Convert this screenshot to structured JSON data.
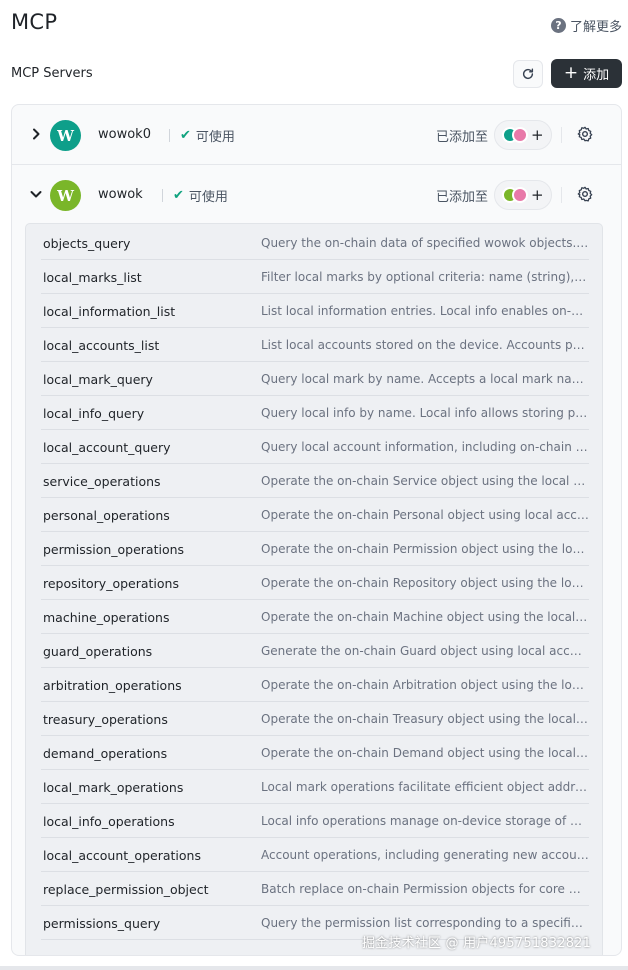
{
  "header": {
    "title": "MCP",
    "learn_more": "了解更多",
    "help_icon": "question-circle-icon"
  },
  "toolbar": {
    "section_title": "MCP Servers",
    "refresh_icon": "refresh-icon",
    "add_label": "添加"
  },
  "colors": {
    "accent_dark": "#2b3137",
    "status_green": "#10a37f",
    "avatar_teal": "#0e9f8a",
    "avatar_lime": "#7ab629"
  },
  "servers": [
    {
      "name": "wowok0",
      "avatar_letter": "W",
      "status": "可使用",
      "added_label": "已添加至",
      "expanded": false
    },
    {
      "name": "wowok",
      "avatar_letter": "W",
      "status": "可使用",
      "added_label": "已添加至",
      "expanded": true
    }
  ],
  "tools": [
    {
      "name": "objects_query",
      "description": "Query the on-chain data of specified wowok objects. Input..."
    },
    {
      "name": "local_marks_list",
      "description": "Filter local marks by optional criteria: name (string), tags (..."
    },
    {
      "name": "local_information_list",
      "description": "List local information entries. Local info enables on-device..."
    },
    {
      "name": "local_accounts_list",
      "description": "List local accounts stored on the device. Accounts provide..."
    },
    {
      "name": "local_mark_query",
      "description": "Query local mark by name. Accepts a local mark name (st..."
    },
    {
      "name": "local_info_query",
      "description": "Query local info by name. Local info allows storing perso..."
    },
    {
      "name": "local_account_query",
      "description": "Query local account information, including on-chain addr..."
    },
    {
      "name": "service_operations",
      "description": "Operate the on-chain Service object using the local acco..."
    },
    {
      "name": "personal_operations",
      "description": "Operate the on-chain Personal object using local account..."
    },
    {
      "name": "permission_operations",
      "description": "Operate the on-chain Permission object using the local a..."
    },
    {
      "name": "repository_operations",
      "description": "Operate the on-chain Repository object using the local a..."
    },
    {
      "name": "machine_operations",
      "description": "Operate the on-chain Machine object using the local acc..."
    },
    {
      "name": "guard_operations",
      "description": "Generate the on-chain Guard object using local account s..."
    },
    {
      "name": "arbitration_operations",
      "description": "Operate the on-chain Arbitration object using the local a..."
    },
    {
      "name": "treasury_operations",
      "description": "Operate the on-chain Treasury object using the local acc..."
    },
    {
      "name": "demand_operations",
      "description": "Operate the on-chain Demand object using the local acc..."
    },
    {
      "name": "local_mark_operations",
      "description": "Local mark operations facilitate efficient object address ..."
    },
    {
      "name": "local_info_operations",
      "description": "Local info operations manage on-device storage of perso..."
    },
    {
      "name": "local_account_operations",
      "description": "Account operations, including generating new accounts, ..."
    },
    {
      "name": "replace_permission_object",
      "description": "Batch replace on-chain Permission objects for core wowo..."
    },
    {
      "name": "permissions_query",
      "description": "Query the permission list corresponding to a specific add..."
    }
  ],
  "watermark": "掘金技术社区 @ 用户495751832821"
}
